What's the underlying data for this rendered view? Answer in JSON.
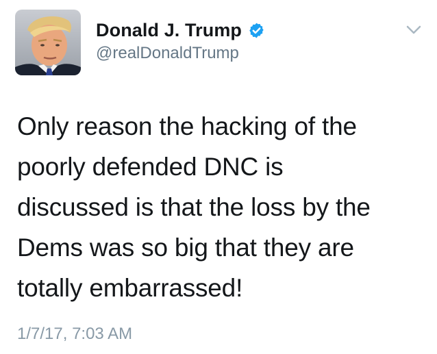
{
  "tweet": {
    "author": {
      "display_name": "Donald J. Trump",
      "handle": "@realDonaldTrump",
      "verified": true,
      "avatar_icon": "profile-photo",
      "verified_icon": "verified-badge-icon"
    },
    "menu_icon": "chevron-down-icon",
    "text_lines": [
      "Only reason the hacking of the",
      "poorly defended DNC is",
      "discussed is that the loss by the",
      "Dems was so big that they are",
      "totally embarrassed!"
    ],
    "timestamp": "1/7/17, 7:03 AM"
  },
  "colors": {
    "verified_blue": "#1da1f2",
    "secondary_text": "#657786",
    "timestamp_text": "#8899a6",
    "primary_text": "#14171a"
  }
}
